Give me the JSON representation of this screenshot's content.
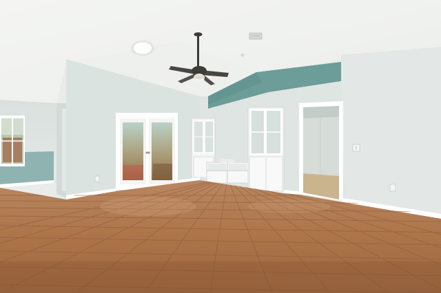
{
  "scene": {
    "subject": "empty-living-room",
    "colors": {
      "ceiling": "#f6f6f4",
      "wall": "#dfe4e2",
      "wall_shadow": "#cfd6d4",
      "accent_wall": "#6f9f9a",
      "accent_lower": "#8fb3b1",
      "trim": "#ffffff",
      "floor_base": "#b27a52",
      "floor_grout": "#8a5c3c",
      "floor_light": "#c48c62",
      "glass": "#cfe0d8",
      "fan_dark": "#3e3a36"
    },
    "icons": {
      "ceiling_fan": "ceiling-fan-icon",
      "recessed_light": "recessed-light-icon",
      "air_vent": "air-vent-icon",
      "outlet": "outlet-icon",
      "light_switch": "light-switch-icon"
    }
  }
}
